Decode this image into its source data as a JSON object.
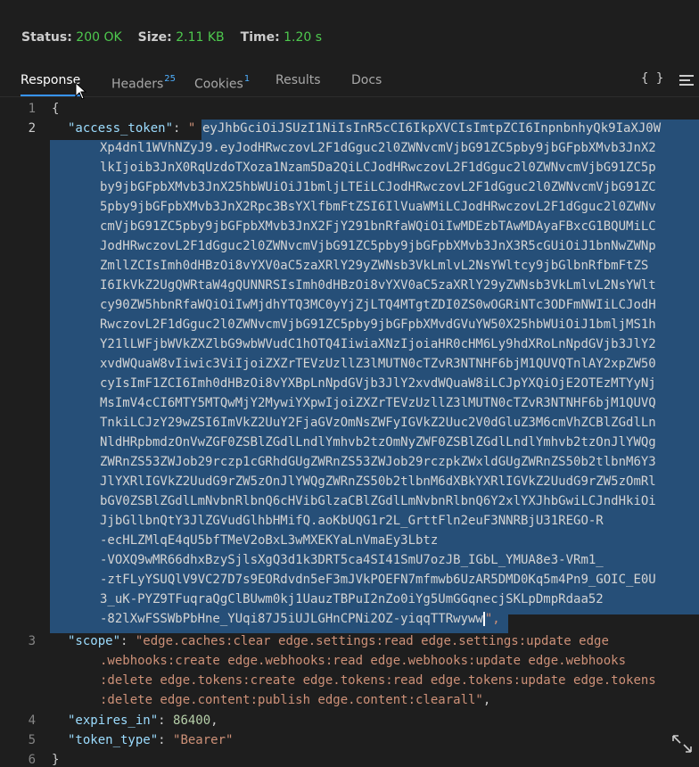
{
  "status": {
    "status_label": "Status:",
    "status_value": "200 OK",
    "size_label": "Size:",
    "size_value": "2.11 KB",
    "time_label": "Time:",
    "time_value": "1.20 s"
  },
  "tabs": {
    "response": "Response",
    "headers": "Headers",
    "headers_count": "25",
    "cookies": "Cookies",
    "cookies_count": "1",
    "results": "Results",
    "docs": "Docs",
    "braces": "{ }"
  },
  "code": {
    "line_numbers": [
      "1",
      "2",
      "3",
      "4",
      "5",
      "6"
    ],
    "open_brace": "{",
    "close_brace": "}",
    "access_token_key": "\"access_token\"",
    "access_token_prefix": "\"",
    "access_token_lines": [
      "eyJhbGciOiJSUzI1NiIsInR5cCI6IkpXVCIsImtpZCI6InpnbnhyQk9IaXJ0W",
      "Xp4dnl1WVhNZyJ9.eyJodHRwczovL2F1dGguc2l0ZWNvcmVjbG91ZC5pby9jbGFpbXMvb3JnX2",
      "lkIjoib3JnX0RqUzdoTXoza1Nzam5Da2QiLCJodHRwczovL2F1dGguc2l0ZWNvcmVjbG91ZC5p",
      "by9jbGFpbXMvb3JnX25hbWUiOiJ1bmljLTEiLCJodHRwczovL2F1dGguc2l0ZWNvcmVjbG91ZC",
      "5pby9jbGFpbXMvb3JnX2Rpc3BsYXlfbmFtZSI6IlVuaWMiLCJodHRwczovL2F1dGguc2l0ZWNv",
      "cmVjbG91ZC5pby9jbGFpbXMvb3JnX2FjY291bnRfaWQiOiIwMDEzbTAwMDAyaFBxcG1BQUMiLC",
      "JodHRwczovL2F1dGguc2l0ZWNvcmVjbG91ZC5pby9jbGFpbXMvb3JnX3R5cGUiOiJ1bnNwZWNp",
      "ZmllZCIsImh0dHBzOi8vYXV0aC5zaXRlY29yZWNsb3VkLmlvL2NsYWltcy9jbGlbnRfbmFtZS",
      "I6IkVkZ2UgQWRtaW4gQUNNRSIsImh0dHBzOi8vYXV0aC5zaXRlY29yZWNsb3VkLmlvL2NsYWlt",
      "cy90ZW5hbnRfaWQiOiIwMjdhYTQ3MC0yYjZjLTQ4MTgtZDI0ZS0wOGRiNTc3ODFmNWIiLCJodH",
      "RwczovL2F1dGguc2l0ZWNvcmVjbG91ZC5pby9jbGFpbXMvdGVuYW50X25hbWUiOiJ1bmljMS1h",
      "Y21lLWFjbWVkZXZlbG9wbWVudC1hOTQ4IiwiaXNzIjoiaHR0cHM6Ly9hdXRoLnNpdGVjb3JlY2",
      "xvdWQuaW8vIiwic3ViIjoiZXZrTEVzUzllZ3lMUTN0cTZvR3NTNHF6bjM1QUVQTnlAY2xpZW50",
      "cyIsImF1ZCI6Imh0dHBzOi8vYXBpLnNpdGVjb3JlY2xvdWQuaW8iLCJpYXQiOjE2OTEzMTYyNj",
      "MsImV4cCI6MTY5MTQwMjY2MywiYXpwIjoiZXZrTEVzUzllZ3lMUTN0cTZvR3NTNHF6bjM1QUVQ",
      "TnkiLCJzY29wZSI6ImVkZ2UuY2FjaGVzOmNsZWFyIGVkZ2Uuc2V0dGluZ3M6cmVhZCBlZGdlLn",
      "NldHRpbmdzOnVwZGF0ZSBlZGdlLndlYmhvb2tzOmNyZWF0ZSBlZGdlLndlYmhvb2tzOnJlYWQg",
      "ZWRnZS53ZWJob29rczp1cGRhdGUgZWRnZS53ZWJob29rczpkZWxldGUgZWRnZS50b2tlbnM6Y3",
      "JlYXRlIGVkZ2UudG9rZW5zOnJlYWQgZWRnZS50b2tlbnM6dXBkYXRlIGVkZ2UudG9rZW5zOmRl",
      "bGV0ZSBlZGdlLmNvbnRlbnQ6cHVibGlzaCBlZGdlLmNvbnRlbnQ6Y2xlYXJhbGwiLCJndHkiOi",
      "JjbGllbnQtY3JlZGVudGlhbHMifQ.aoKbUQG1r2L_GrttFln2euF3NNRBjU31REGO-R",
      "-ecHLZMlqE4qU5bfTMeV2oBxL3wMXEKYaLnVmaEy3Lbtz",
      "-VOXQ9wMR66dhxBzySjlsXgQ3d1k3DRT5ca4SI41SmU7ozJB_IGbL_YMUA8e3-VRm1_",
      "-ztFLyYSUQlV9VC27D7s9EORdvdn5eF3mJVkPOEFN7mfmwb6UzAR5DMD0Kq5m4Pn9_GOIC_E0U",
      "3_uK-PYZ9TFuqraQgClBUwm0kj1UauzTBPuI2nZo0iYg5UmGGqnecjSKLpDmpRdaa52",
      "-82lXwFSSWbPbHne_YUqi87J5iUJLGHnCPNi2OZ-yiqqTTRwyww"
    ],
    "access_token_suffix": "\",",
    "scope_key": "\"scope\"",
    "scope_lines": [
      "\"edge.caches:clear edge.settings:read edge.settings:update edge",
      ".webhooks:create edge.webhooks:read edge.webhooks:update edge.webhooks",
      ":delete edge.tokens:create edge.tokens:read edge.tokens:update edge.tokens",
      ":delete edge.content:publish edge.content:clearall\""
    ],
    "scope_comma": ",",
    "expires_key": "\"expires_in\"",
    "expires_value": "86400",
    "token_type_key": "\"token_type\"",
    "token_type_value": "\"Bearer\"",
    "colon": ": ",
    "comma": ","
  },
  "icons": {
    "menu": "hamburger-menu-icon",
    "expand": "expand-diagonal-icon",
    "cursor": "mouse-pointer-icon"
  },
  "colors": {
    "background": "#1e1e1e",
    "selection": "#264f78",
    "key": "#9cdcfe",
    "string": "#ce9178",
    "number": "#b5cea8",
    "status_ok": "#4ec94e",
    "tab_accent": "#3794ff"
  }
}
